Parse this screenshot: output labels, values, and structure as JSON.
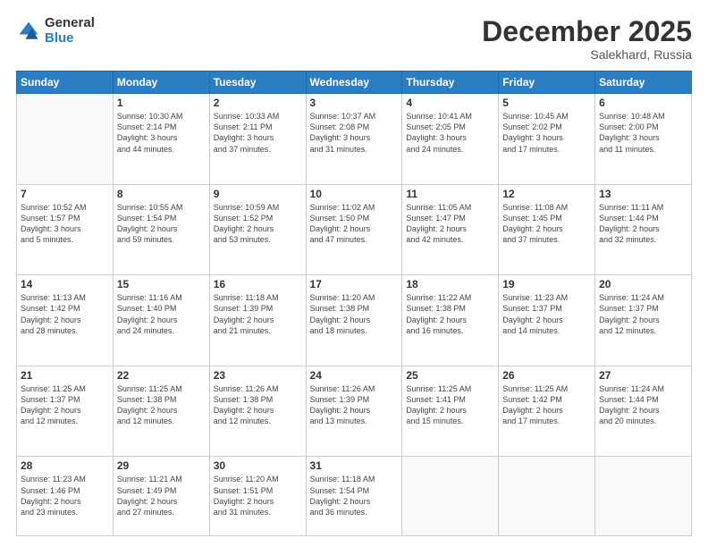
{
  "logo": {
    "general": "General",
    "blue": "Blue"
  },
  "header": {
    "month": "December 2025",
    "location": "Salekhard, Russia"
  },
  "weekdays": [
    "Sunday",
    "Monday",
    "Tuesday",
    "Wednesday",
    "Thursday",
    "Friday",
    "Saturday"
  ],
  "weeks": [
    [
      {
        "day": "",
        "info": ""
      },
      {
        "day": "1",
        "info": "Sunrise: 10:30 AM\nSunset: 2:14 PM\nDaylight: 3 hours\nand 44 minutes."
      },
      {
        "day": "2",
        "info": "Sunrise: 10:33 AM\nSunset: 2:11 PM\nDaylight: 3 hours\nand 37 minutes."
      },
      {
        "day": "3",
        "info": "Sunrise: 10:37 AM\nSunset: 2:08 PM\nDaylight: 3 hours\nand 31 minutes."
      },
      {
        "day": "4",
        "info": "Sunrise: 10:41 AM\nSunset: 2:05 PM\nDaylight: 3 hours\nand 24 minutes."
      },
      {
        "day": "5",
        "info": "Sunrise: 10:45 AM\nSunset: 2:02 PM\nDaylight: 3 hours\nand 17 minutes."
      },
      {
        "day": "6",
        "info": "Sunrise: 10:48 AM\nSunset: 2:00 PM\nDaylight: 3 hours\nand 11 minutes."
      }
    ],
    [
      {
        "day": "7",
        "info": "Sunrise: 10:52 AM\nSunset: 1:57 PM\nDaylight: 3 hours\nand 5 minutes."
      },
      {
        "day": "8",
        "info": "Sunrise: 10:55 AM\nSunset: 1:54 PM\nDaylight: 2 hours\nand 59 minutes."
      },
      {
        "day": "9",
        "info": "Sunrise: 10:59 AM\nSunset: 1:52 PM\nDaylight: 2 hours\nand 53 minutes."
      },
      {
        "day": "10",
        "info": "Sunrise: 11:02 AM\nSunset: 1:50 PM\nDaylight: 2 hours\nand 47 minutes."
      },
      {
        "day": "11",
        "info": "Sunrise: 11:05 AM\nSunset: 1:47 PM\nDaylight: 2 hours\nand 42 minutes."
      },
      {
        "day": "12",
        "info": "Sunrise: 11:08 AM\nSunset: 1:45 PM\nDaylight: 2 hours\nand 37 minutes."
      },
      {
        "day": "13",
        "info": "Sunrise: 11:11 AM\nSunset: 1:44 PM\nDaylight: 2 hours\nand 32 minutes."
      }
    ],
    [
      {
        "day": "14",
        "info": "Sunrise: 11:13 AM\nSunset: 1:42 PM\nDaylight: 2 hours\nand 28 minutes."
      },
      {
        "day": "15",
        "info": "Sunrise: 11:16 AM\nSunset: 1:40 PM\nDaylight: 2 hours\nand 24 minutes."
      },
      {
        "day": "16",
        "info": "Sunrise: 11:18 AM\nSunset: 1:39 PM\nDaylight: 2 hours\nand 21 minutes."
      },
      {
        "day": "17",
        "info": "Sunrise: 11:20 AM\nSunset: 1:38 PM\nDaylight: 2 hours\nand 18 minutes."
      },
      {
        "day": "18",
        "info": "Sunrise: 11:22 AM\nSunset: 1:38 PM\nDaylight: 2 hours\nand 16 minutes."
      },
      {
        "day": "19",
        "info": "Sunrise: 11:23 AM\nSunset: 1:37 PM\nDaylight: 2 hours\nand 14 minutes."
      },
      {
        "day": "20",
        "info": "Sunrise: 11:24 AM\nSunset: 1:37 PM\nDaylight: 2 hours\nand 12 minutes."
      }
    ],
    [
      {
        "day": "21",
        "info": "Sunrise: 11:25 AM\nSunset: 1:37 PM\nDaylight: 2 hours\nand 12 minutes."
      },
      {
        "day": "22",
        "info": "Sunrise: 11:25 AM\nSunset: 1:38 PM\nDaylight: 2 hours\nand 12 minutes."
      },
      {
        "day": "23",
        "info": "Sunrise: 11:26 AM\nSunset: 1:38 PM\nDaylight: 2 hours\nand 12 minutes."
      },
      {
        "day": "24",
        "info": "Sunrise: 11:26 AM\nSunset: 1:39 PM\nDaylight: 2 hours\nand 13 minutes."
      },
      {
        "day": "25",
        "info": "Sunrise: 11:25 AM\nSunset: 1:41 PM\nDaylight: 2 hours\nand 15 minutes."
      },
      {
        "day": "26",
        "info": "Sunrise: 11:25 AM\nSunset: 1:42 PM\nDaylight: 2 hours\nand 17 minutes."
      },
      {
        "day": "27",
        "info": "Sunrise: 11:24 AM\nSunset: 1:44 PM\nDaylight: 2 hours\nand 20 minutes."
      }
    ],
    [
      {
        "day": "28",
        "info": "Sunrise: 11:23 AM\nSunset: 1:46 PM\nDaylight: 2 hours\nand 23 minutes."
      },
      {
        "day": "29",
        "info": "Sunrise: 11:21 AM\nSunset: 1:49 PM\nDaylight: 2 hours\nand 27 minutes."
      },
      {
        "day": "30",
        "info": "Sunrise: 11:20 AM\nSunset: 1:51 PM\nDaylight: 2 hours\nand 31 minutes."
      },
      {
        "day": "31",
        "info": "Sunrise: 11:18 AM\nSunset: 1:54 PM\nDaylight: 2 hours\nand 36 minutes."
      },
      {
        "day": "",
        "info": ""
      },
      {
        "day": "",
        "info": ""
      },
      {
        "day": "",
        "info": ""
      }
    ]
  ]
}
